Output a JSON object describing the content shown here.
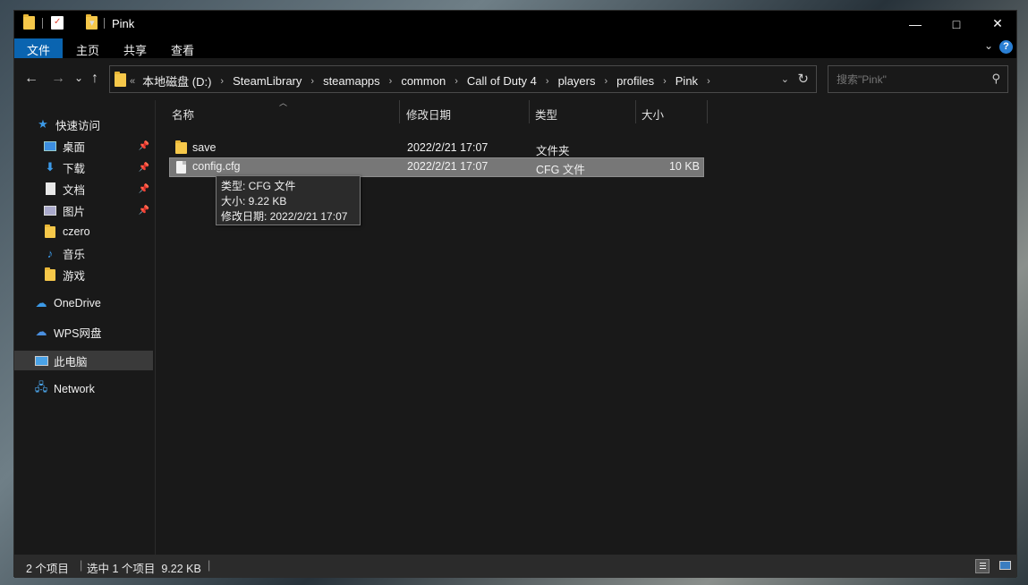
{
  "titlebar": {
    "title": "Pink",
    "qa_dropdown": "▾",
    "minimize": "—",
    "maximize": "□",
    "close": "✕"
  },
  "ribbon": {
    "tabs": [
      "文件",
      "主页",
      "共享",
      "查看"
    ],
    "help": "?",
    "collapse": "⌄"
  },
  "nav": {
    "back": "←",
    "forward": "→",
    "recent": "⌄",
    "up": "↑",
    "overflow": "«",
    "breadcrumbs": [
      "本地磁盘 (D:)",
      "SteamLibrary",
      "steamapps",
      "common",
      "Call of Duty 4",
      "players",
      "profiles",
      "Pink"
    ],
    "search_placeholder": "搜索\"Pink\""
  },
  "sidebar": {
    "items": [
      {
        "label": "快速访问",
        "icon": "star-icon"
      },
      {
        "label": "桌面",
        "icon": "desktop-icon",
        "pinned": true
      },
      {
        "label": "下载",
        "icon": "download-icon",
        "pinned": true
      },
      {
        "label": "文档",
        "icon": "document-icon",
        "pinned": true
      },
      {
        "label": "图片",
        "icon": "picture-icon",
        "pinned": true
      },
      {
        "label": "czero",
        "icon": "folder-icon"
      },
      {
        "label": "音乐",
        "icon": "music-icon"
      },
      {
        "label": "游戏",
        "icon": "folder-icon"
      },
      {
        "label": "OneDrive",
        "icon": "cloud-icon"
      },
      {
        "label": "WPS网盘",
        "icon": "cloud-icon"
      },
      {
        "label": "此电脑",
        "icon": "computer-icon",
        "selected": true
      },
      {
        "label": "Network",
        "icon": "network-icon"
      }
    ]
  },
  "columns": [
    "名称",
    "修改日期",
    "类型",
    "大小"
  ],
  "files": [
    {
      "name": "save",
      "date": "2022/2/21 17:07",
      "type": "文件夹",
      "size": "",
      "icon": "folder-icon"
    },
    {
      "name": "config.cfg",
      "date": "2022/2/21 17:07",
      "type": "CFG 文件",
      "size": "10 KB",
      "icon": "file-icon",
      "selected": true
    }
  ],
  "tooltip": {
    "type": "类型: CFG 文件",
    "size": "大小: 9.22 KB",
    "date": "修改日期: 2022/2/21 17:07"
  },
  "status": {
    "count": "2 个项目",
    "selected": "选中 1 个项目  9.22 KB"
  },
  "colors": {
    "accent": "#0a64b0",
    "folder": "#f6c84a",
    "background": "#191919"
  }
}
